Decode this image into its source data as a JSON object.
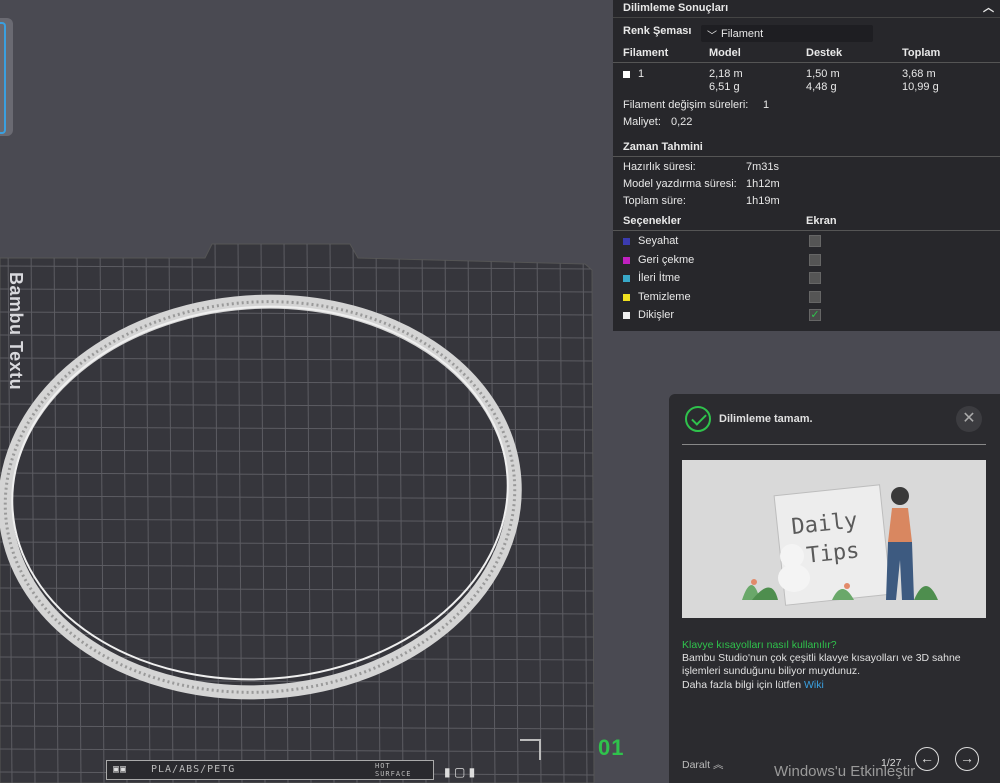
{
  "results": {
    "title": "Dilimleme Sonuçları",
    "color_scheme_label": "Renk Şeması",
    "color_scheme_value": "Filament",
    "columns": [
      "Filament",
      "Model",
      "Destek",
      "Toplam"
    ],
    "filament_row": {
      "id": "1",
      "model_len": "2,18 m",
      "model_wt": "6,51 g",
      "support_len": "1,50 m",
      "support_wt": "4,48 g",
      "total_len": "3,68 m",
      "total_wt": "10,99 g"
    },
    "change_times_label": "Filament değişim süreleri:",
    "change_times_value": "1",
    "cost_label": "Maliyet:",
    "cost_value": "0,22",
    "time_title": "Zaman Tahmini",
    "prep_label": "Hazırlık süresi:",
    "prep_value": "7m31s",
    "model_print_label": "Model yazdırma süresi:",
    "model_print_value": "1h12m",
    "total_time_label": "Toplam süre:",
    "total_time_value": "1h19m",
    "options_label": "Seçenekler",
    "display_label": "Ekran",
    "options": [
      {
        "label": "Seyahat",
        "color": "#3b3bb0",
        "checked": false
      },
      {
        "label": "Geri çekme",
        "color": "#c020c0",
        "checked": false
      },
      {
        "label": "İleri İtme",
        "color": "#38a8c8",
        "checked": false
      },
      {
        "label": "Temizleme",
        "color": "#f0e020",
        "checked": false
      },
      {
        "label": "Dikişler",
        "color": "#f0f0f0",
        "checked": true
      }
    ]
  },
  "viewport": {
    "bed_brand": "Bambu Textu",
    "plate_number": "01",
    "plate_label": "PLA/ABS/PETG",
    "plate_label_2": "HOT SURFACE"
  },
  "toast": {
    "title": "Dilimleme tamam.",
    "image_text_1": "Daily",
    "image_text_2": "Tips",
    "question": "Klavye kısayolları nasıl kullanılır?",
    "body": "Bambu Studio'nun çok çeşitli klavye kısayolları ve 3D sahne işlemleri sunduğunu biliyor muydunuz.",
    "more_prefix": "Daha fazla bilgi için lütfen",
    "more_link": "Wiki",
    "collapse": "Daralt",
    "pager": "1/27"
  },
  "watermark": "Windows'u Etkinleştir"
}
